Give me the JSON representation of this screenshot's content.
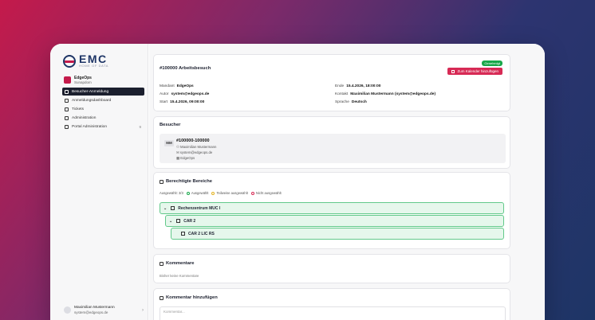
{
  "brand": {
    "title": "EMC",
    "subtitle": "HOME OF DATA"
  },
  "tenant": {
    "name": "EdgeOps",
    "sub": "Sunapdom"
  },
  "nav": [
    {
      "label": "Besucher-Anmeldung",
      "active": true
    },
    {
      "label": "Anmeldungsdashboard",
      "active": false
    },
    {
      "label": "Tickets",
      "active": false
    },
    {
      "label": "Administration",
      "active": false
    },
    {
      "label": "Portal Administration",
      "active": false,
      "badge": "9"
    }
  ],
  "user": {
    "name": "Maximilian Mustermann",
    "email": "system@edgeops.de"
  },
  "visit": {
    "title": "#100000 Arbeitsbesuch",
    "status": "Genehmigt",
    "calendar_button": "Zum Kalender hinzufügen",
    "fields": [
      {
        "label": "Mandant",
        "value": "EdgeOps"
      },
      {
        "label": "Autor",
        "value": "system@edgeops.de"
      },
      {
        "label": "Start",
        "value": "15.4.2026, 09:00:00"
      },
      {
        "label": "Ende",
        "value": "15.4.2026, 18:00:00"
      },
      {
        "label": "Kontakt",
        "value": "Maximilian Mustermann (system@edgeops.de)"
      },
      {
        "label": "Sprache",
        "value": "Deutsch"
      }
    ]
  },
  "visitors": {
    "title": "Besucher",
    "items": [
      {
        "initials": "MM",
        "id": "#100000-100000",
        "name": "Maximilian Mustermann",
        "email": "system@edgeops.de",
        "company": "EdgeOps"
      }
    ]
  },
  "areas": {
    "title": "Berechtigte Bereiche",
    "legend": {
      "selected": "Ausgewählt: 3/3",
      "chosen": "Ausgewählt",
      "partial": "Teilweise ausgewählt",
      "none": "Nicht ausgewählt"
    },
    "tree": [
      {
        "label": "Rechenzentrum MUC I",
        "level": 0
      },
      {
        "label": "CAR 2",
        "level": 1
      },
      {
        "label": "CAR 2 LIC RS",
        "level": 2
      }
    ]
  },
  "comments": {
    "title": "Kommentare",
    "empty": "Bisher keine Kommentare"
  },
  "add_comment": {
    "title": "Kommentar hinzufügen",
    "placeholder": "Kommentar..."
  },
  "colors": {
    "accent": "#d72a55",
    "status": "#18a84a",
    "tree_bg": "#e6f7ec",
    "tree_border": "#62c98a"
  }
}
